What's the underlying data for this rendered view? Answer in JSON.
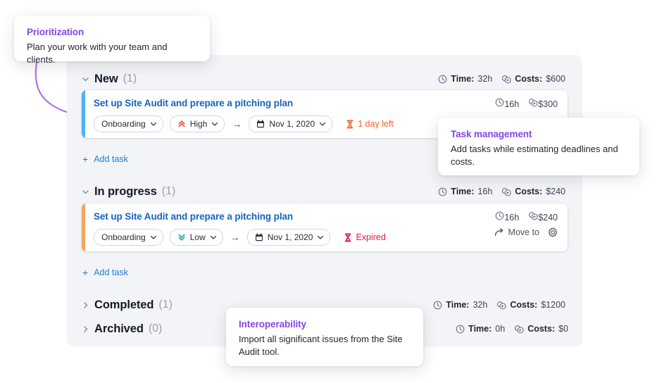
{
  "colors": {
    "panel_bg": "#f3f4f7",
    "accent_new": "#4bb3f5",
    "accent_inprogress": "#f5a45c",
    "link_blue": "#1464c0",
    "callout_purple": "#8345e6",
    "arrow_purple": "#a96ee8",
    "priority_high": "#f4483a",
    "priority_low": "#11ab93",
    "due_soon": "#f2622c",
    "expired": "#e01b47"
  },
  "callouts": [
    {
      "id": "prioritization",
      "title": "Prioritization",
      "body": "Plan your work with your team and clients."
    },
    {
      "id": "task-management",
      "title": "Task management",
      "body": "Add tasks while estimating deadlines and costs."
    },
    {
      "id": "interoperability",
      "title": "Interoperability",
      "body": "Import all significant issues from the Site Audit tool."
    }
  ],
  "stat_labels": {
    "time": "Time:",
    "costs": "Costs:"
  },
  "groups": [
    {
      "id": "new",
      "title": "New",
      "count": "(1)",
      "expanded": true,
      "caret": "chevron-down-icon",
      "stats": {
        "time": "32h",
        "costs": "$600"
      },
      "add_task_label": "Add task",
      "tasks": [
        {
          "title": "Set up Site Audit and prepare a pitching plan",
          "accent": "#4bb3f5",
          "time": "16h",
          "cost": "$300",
          "project": "Onboarding",
          "priority": {
            "label": "High",
            "icon": "chevrons-up-icon",
            "color": "#f4483a"
          },
          "date": "Nov 1, 2020",
          "deadline": {
            "label": "1 day left",
            "icon": "hourglass-icon",
            "color": "#f2622c"
          },
          "show_actions": false,
          "move_to_label": "Move to"
        }
      ]
    },
    {
      "id": "in-progress",
      "title": "In progress",
      "count": "(1)",
      "expanded": true,
      "caret": "chevron-down-icon",
      "stats": {
        "time": "16h",
        "costs": "$240"
      },
      "add_task_label": "Add task",
      "tasks": [
        {
          "title": "Set up Site Audit and prepare a pitching plan",
          "accent": "#f5a45c",
          "time": "16h",
          "cost": "$240",
          "project": "Onboarding",
          "priority": {
            "label": "Low",
            "icon": "chevrons-down-icon",
            "color": "#11ab93"
          },
          "date": "Nov 1, 2020",
          "deadline": {
            "label": "Expired",
            "icon": "hourglass-icon",
            "color": "#e01b47"
          },
          "show_actions": true,
          "move_to_label": "Move to"
        }
      ]
    },
    {
      "id": "completed",
      "title": "Completed",
      "count": "(1)",
      "expanded": false,
      "caret": "chevron-right-icon",
      "stats": {
        "time": "32h",
        "costs": "$1200"
      },
      "tasks": []
    },
    {
      "id": "archived",
      "title": "Archived",
      "count": "(0)",
      "expanded": false,
      "caret": "chevron-right-icon",
      "stats": {
        "time": "0h",
        "costs": "$0"
      },
      "tasks": []
    }
  ]
}
